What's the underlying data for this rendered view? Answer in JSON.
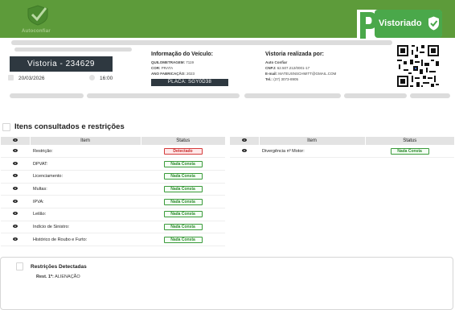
{
  "header": {
    "logo_text": "Autoconfiar",
    "badge_label": "Vistoriado",
    "colors": {
      "header_bg": "#5d9b3a",
      "badge_bg": "#4aa84a",
      "dark": "#2e3840",
      "ok": "#2f8a2f",
      "bad": "#c82a2a"
    }
  },
  "vistoria": {
    "title": "Vistoria - 234629",
    "date": "20/03/2026",
    "time": "16:00"
  },
  "veiculo": {
    "title": "Informação do Veículo:",
    "quilometragem_label": "QUILOMETRAGEM:",
    "quilometragem_value": "7119",
    "cor_label": "COR:",
    "cor_value": "PRATA",
    "ano_label": "ANO FABRICAÇÃO:",
    "ano_value": "2023",
    "placa": "PLACA: SGY0D38"
  },
  "realizada": {
    "title": "Vistoria realizada por:",
    "empresa": "Auto Confiar",
    "cnpj_label": "CNPJ:",
    "cnpj_value": "62.507.212/0001-17",
    "email_label": "E-mail:",
    "email_value": "MATEUSNSCHMITT@GMAIL.COM",
    "tel_label": "Tel.:",
    "tel_value": "(37) 3073-8905"
  },
  "section": {
    "title": "Itens consultados e restrições"
  },
  "table_headers": {
    "item": "Item",
    "status": "Status"
  },
  "table_left": [
    {
      "item": "Restrição:",
      "status": "Detectado",
      "level": "bad"
    },
    {
      "item": "DPVAT:",
      "status": "Nada Consta",
      "level": "ok"
    },
    {
      "item": "Licenciamento:",
      "status": "Nada Consta",
      "level": "ok"
    },
    {
      "item": "Multas:",
      "status": "Nada Consta",
      "level": "ok"
    },
    {
      "item": "IPVA:",
      "status": "Nada Consta",
      "level": "ok"
    },
    {
      "item": "Leilão:",
      "status": "Nada Consta",
      "level": "ok"
    },
    {
      "item": "Indício de Sinistro:",
      "status": "Nada Consta",
      "level": "ok"
    },
    {
      "item": "Histórico de Roubo e Furto:",
      "status": "Nada Consta",
      "level": "ok"
    }
  ],
  "table_right": [
    {
      "item": "Divergência nº Motor:",
      "status": "Nada Consta",
      "level": "ok"
    }
  ],
  "restricoes": {
    "title": "Restrições Detectadas",
    "line_label": "Rest. 1º:",
    "line_value": "ALIENAÇÃO"
  }
}
